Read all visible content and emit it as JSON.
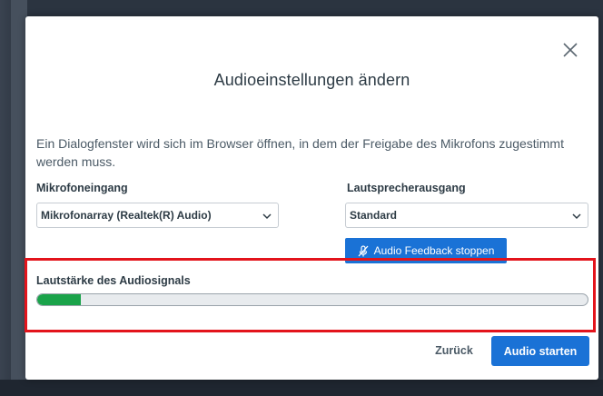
{
  "dialog": {
    "title": "Audioeinstellungen ändern",
    "description": "Ein Dialogfenster wird sich im Browser öffnen, in dem der Freigabe des Mikrofons zugestimmt werden muss.",
    "close_icon": "close-icon"
  },
  "microphone": {
    "label": "Mikrofoneingang",
    "selected": "Mikrofonarray (Realtek(R) Audio)"
  },
  "speaker": {
    "label": "Lautsprecherausgang",
    "selected": "Standard"
  },
  "feedback_button": {
    "label": "Audio Feedback stoppen",
    "icon": "microphone-off-icon"
  },
  "volume": {
    "label": "Lautstärke des Audiosignals",
    "level_fraction": 0.08
  },
  "footer": {
    "back_label": "Zurück",
    "start_label": "Audio starten"
  },
  "colors": {
    "primary": "#1a72d6",
    "meter_fill": "#1aa34a",
    "highlight": "#e3141c"
  }
}
